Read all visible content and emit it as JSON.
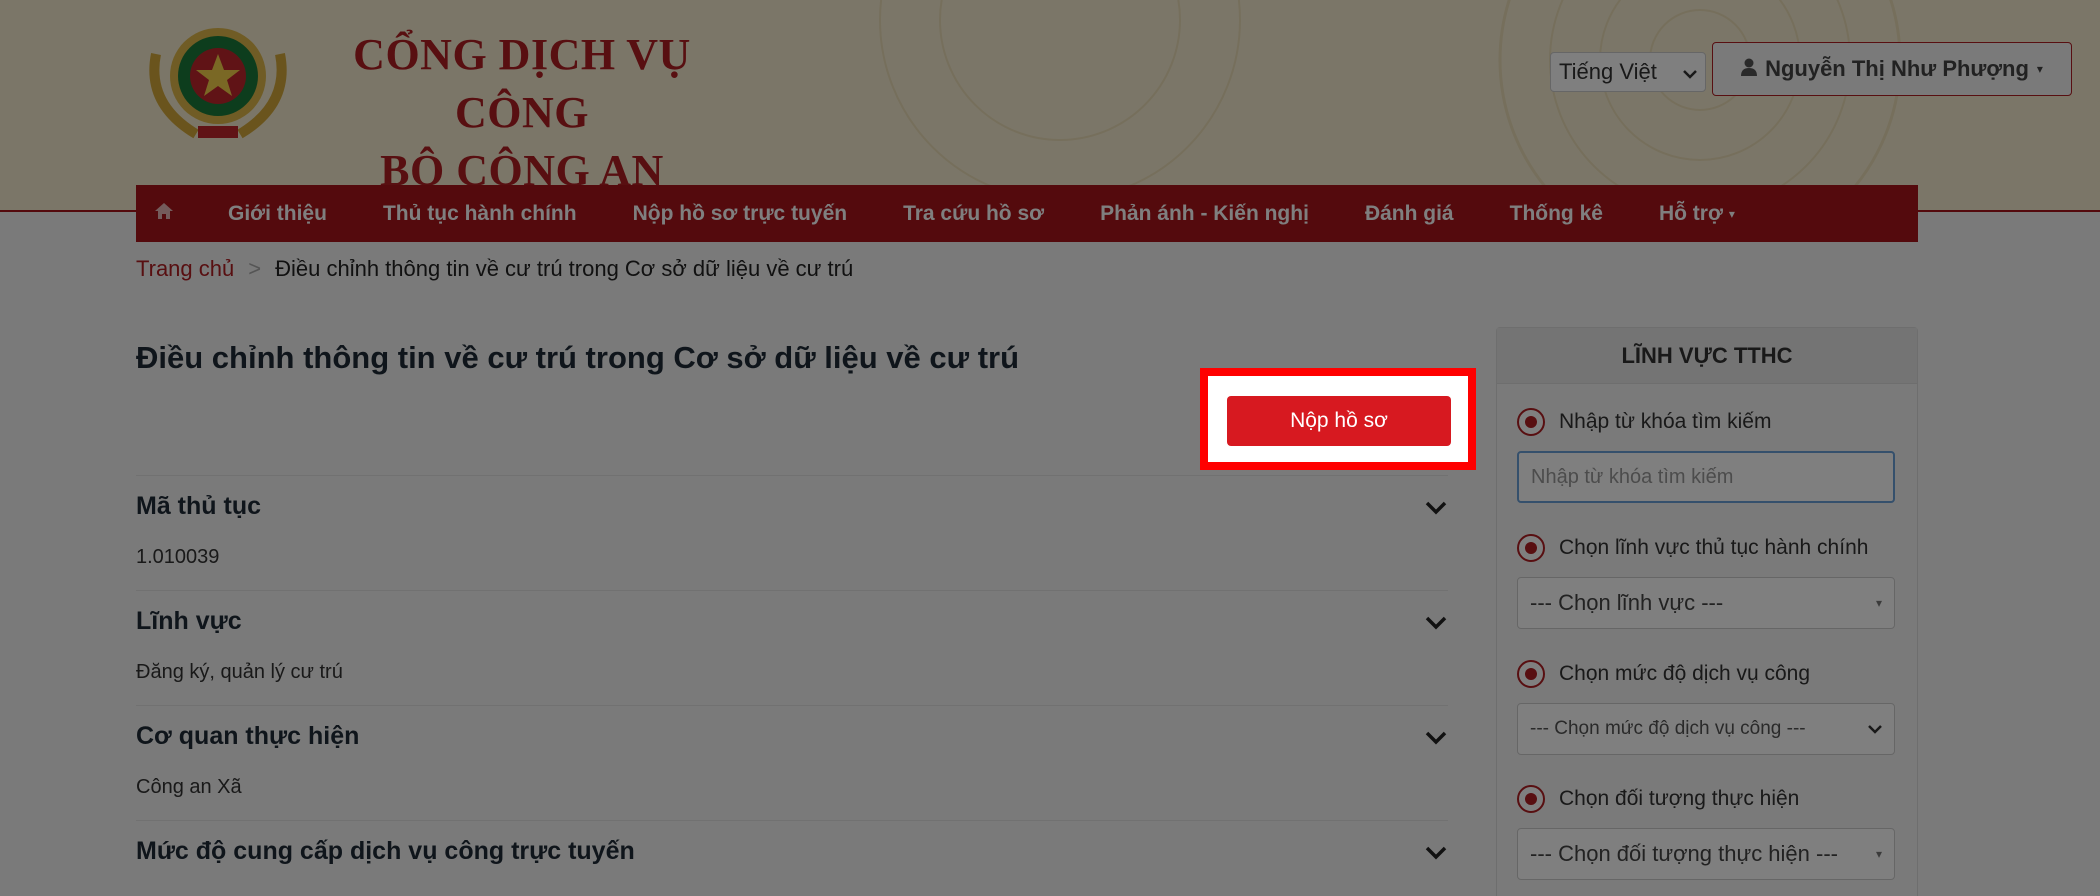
{
  "header": {
    "logo_line1": "CỔNG DỊCH VỤ CÔNG",
    "logo_line2": "BỘ CÔNG AN",
    "language": "Tiếng Việt",
    "user_name": "Nguyễn Thị Như Phượng"
  },
  "nav": {
    "home_icon": "home-icon",
    "items": [
      {
        "label": "Giới thiệu"
      },
      {
        "label": "Thủ tục hành chính"
      },
      {
        "label": "Nộp hồ sơ trực tuyến"
      },
      {
        "label": "Tra cứu hồ sơ"
      },
      {
        "label": "Phản ánh - Kiến nghị"
      },
      {
        "label": "Đánh giá"
      },
      {
        "label": "Thống kê"
      },
      {
        "label": "Hỗ trợ"
      }
    ]
  },
  "breadcrumb": {
    "home": "Trang chủ",
    "separator": ">",
    "current": "Điều chỉnh thông tin về cư trú trong Cơ sở dữ liệu về cư trú"
  },
  "main": {
    "title": "Điều chỉnh thông tin về cư trú trong Cơ sở dữ liệu về cư trú",
    "submit_label": "Nộp hồ sơ",
    "sections": [
      {
        "title": "Mã thủ tục",
        "value": "1.010039"
      },
      {
        "title": "Lĩnh vực",
        "value": "Đăng ký, quản lý cư trú"
      },
      {
        "title": "Cơ quan thực hiện",
        "value": "Công an Xã"
      },
      {
        "title": "Mức độ cung cấp dịch vụ công trực tuyến",
        "value": ""
      }
    ]
  },
  "sidebar": {
    "title": "LĨNH VỰC TTHC",
    "search_label": "Nhập từ khóa tìm kiếm",
    "search_placeholder": "Nhập từ khóa tìm kiếm",
    "field_label": "Chọn lĩnh vực thủ tục hành chính",
    "field_value": "--- Chọn lĩnh vực ---",
    "level_label": "Chọn mức độ dịch vụ công",
    "level_value": "--- Chọn mức độ dịch vụ công ---",
    "target_label": "Chọn đối tượng thực hiện",
    "target_value": "--- Chọn đối tượng thực hiện ---"
  },
  "colors": {
    "brand_red": "#a8141a",
    "button_red": "#d71920",
    "highlight": "#ff0000"
  }
}
